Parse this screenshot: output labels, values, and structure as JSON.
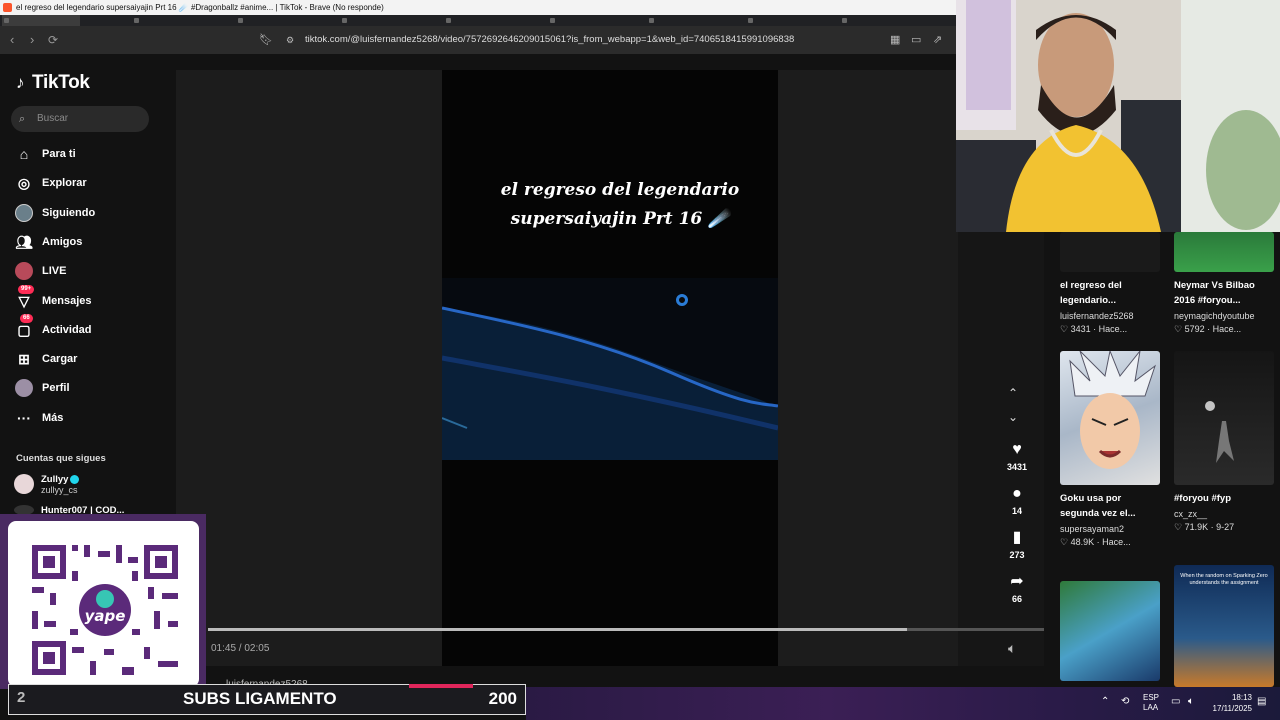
{
  "window": {
    "title": "el regreso del legendario supersaiyajin Prt 16 ☄️ #Dragonballz #anime... | TikTok - Brave (No responde)"
  },
  "browser": {
    "url": "tiktok.com/@luisfernandez5268/video/7572692646209015061?is_from_webapp=1&web_id=7406518415991096838"
  },
  "tiktok": {
    "logo": "TikTok",
    "search_placeholder": "Buscar",
    "nav": [
      {
        "label": "Para ti",
        "icon": "home-icon"
      },
      {
        "label": "Explorar",
        "icon": "compass-icon"
      },
      {
        "label": "Siguiendo",
        "icon": "following-avatar-icon"
      },
      {
        "label": "Amigos",
        "icon": "friends-icon"
      },
      {
        "label": "LIVE",
        "icon": "live-icon"
      },
      {
        "label": "Mensajes",
        "icon": "messages-icon",
        "badge": "99+"
      },
      {
        "label": "Actividad",
        "icon": "activity-icon",
        "badge": "66"
      },
      {
        "label": "Cargar",
        "icon": "upload-icon"
      },
      {
        "label": "Perfil",
        "icon": "profile-icon"
      },
      {
        "label": "Más",
        "icon": "more-icon"
      }
    ],
    "following_title": "Cuentas que sigues",
    "following": [
      {
        "name": "Zullyy",
        "handle": "zullyy_cs"
      },
      {
        "name": "Hunter007 | COD...",
        "handle": ""
      }
    ]
  },
  "video": {
    "caption_line1": "el regreso del legendario",
    "caption_line2": "supersaiyajin Prt 16 ☄️",
    "time": "01:45 / 02:05",
    "progress": 0.836,
    "author_partial": "luisfernandez5268",
    "likes": "3431",
    "comments": "14",
    "saves": "273",
    "shares": "66"
  },
  "recommendations": [
    {
      "title": "el regreso del legendario...",
      "user": "luisfernandez5268",
      "likes": "3431",
      "when": "Hace..."
    },
    {
      "title": "Neymar Vs Bilbao 2016 #foryou...",
      "user": "neymagichdyoutube",
      "likes": "5792",
      "when": "Hace..."
    },
    {
      "title": "Goku usa por segunda vez el...",
      "user": "supersayaman2",
      "likes": "48.9K",
      "when": "Hace..."
    },
    {
      "title": "#foryou #fyp",
      "user": "cx_zx__",
      "likes": "71.9K",
      "when": "9-27"
    },
    {
      "title": "",
      "user": "",
      "likes": "",
      "when": ""
    },
    {
      "title": "When the random on Sparking Zero understands the assignment",
      "user": "",
      "likes": "",
      "when": ""
    }
  ],
  "overlay": {
    "subs_count": "2",
    "subs_label": "SUBS LIGAMENTO",
    "subs_goal": "200",
    "qr_brand": "yape"
  },
  "taskbar": {
    "lang1": "ESP",
    "lang2": "LAA",
    "time": "18:13",
    "date": "17/11/2025"
  },
  "colors": {
    "accent": "#fe2c55",
    "verified": "#20d5ec",
    "spinner": "#2a7cd6"
  }
}
